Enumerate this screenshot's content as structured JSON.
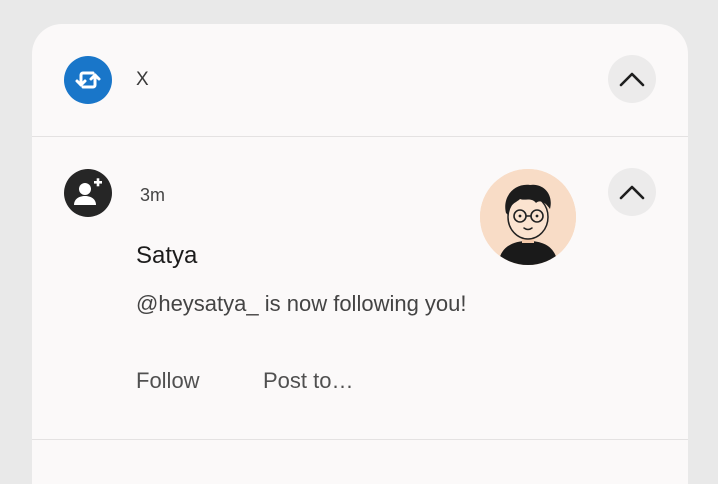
{
  "app": {
    "name": "X",
    "icon": "retweet-icon",
    "accent_color": "#1976c9"
  },
  "notification": {
    "icon": "person-add-icon",
    "time": "3m",
    "title": "Satya",
    "message": "@heysatya_ is now following you!",
    "avatar": "avatar-cartoon-boy-glasses",
    "actions": [
      "Follow",
      "Post to…"
    ]
  }
}
